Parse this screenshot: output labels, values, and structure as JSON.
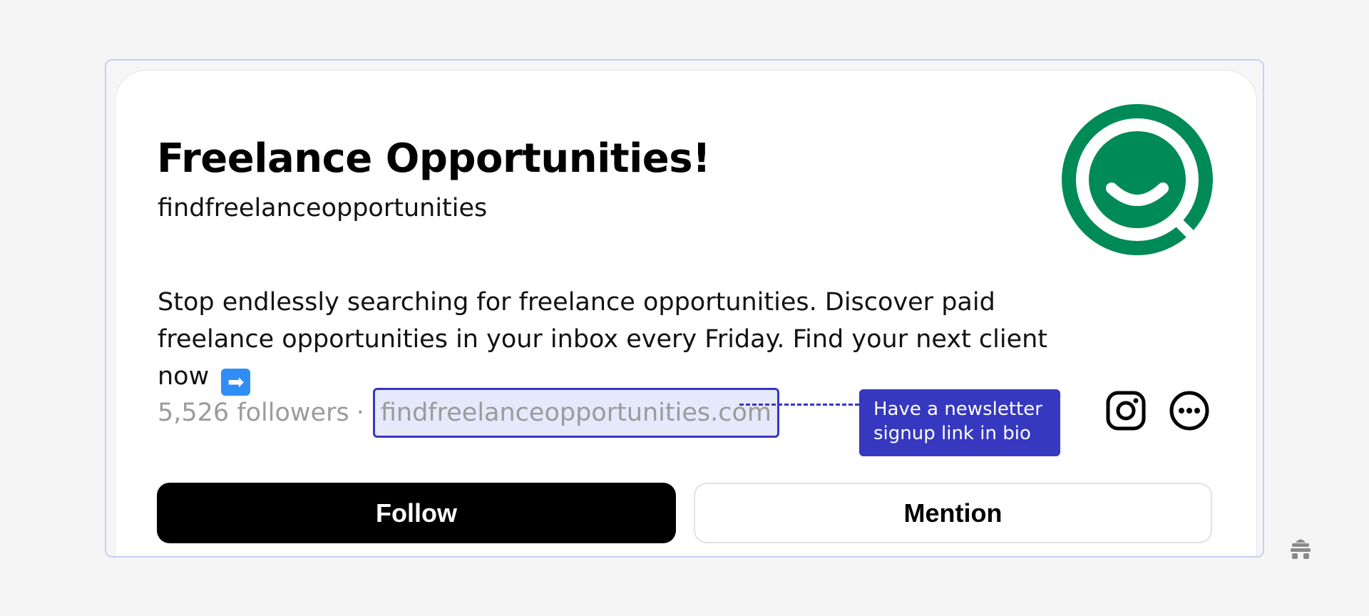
{
  "profile": {
    "display_name": "Freelance Opportunities!",
    "handle": "findfreelanceopportunities",
    "bio": "Stop endlessly searching for freelance opportunities. Discover paid freelance opportunities in your inbox every Friday. Find your next client now",
    "bio_emoji": "➡",
    "followers": "5,526 followers",
    "separator": "·",
    "website": "findfreelanceopportunities.com"
  },
  "annotation": {
    "text": "Have a newsletter signup link in bio"
  },
  "actions": {
    "follow_label": "Follow",
    "mention_label": "Mention"
  },
  "icons": {
    "avatar": "smile-search-logo",
    "social": "instagram-icon",
    "more": "more-options-icon",
    "watermark": "beehive-logo"
  },
  "colors": {
    "brand_green": "#008a57",
    "annotation_blue": "#3638c0",
    "highlight_fill": "#e6e8fb",
    "follow_bg": "#000000"
  }
}
